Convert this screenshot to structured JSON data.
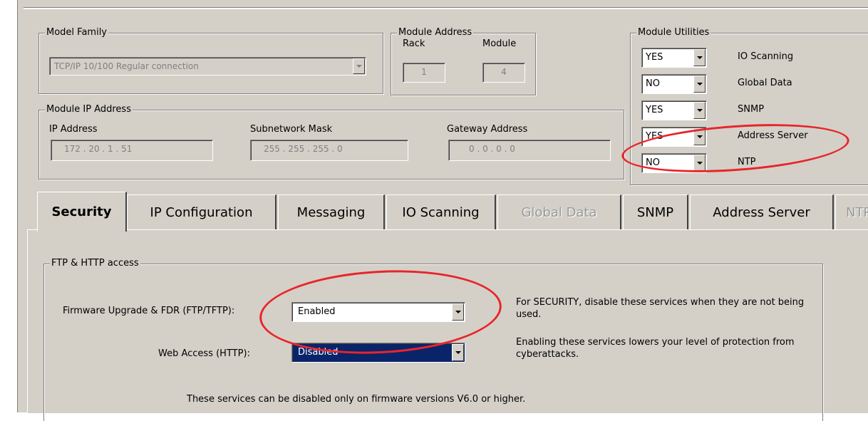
{
  "model_family": {
    "title": "Model Family",
    "value": "TCP/IP 10/100 Regular connection"
  },
  "module_address": {
    "title": "Module Address",
    "rack_label": "Rack",
    "rack_value": "1",
    "module_label": "Module",
    "module_value": "4"
  },
  "module_ip": {
    "title": "Module IP Address",
    "ip_label": "IP Address",
    "ip_value": "172 .  20  .   1   .  51",
    "mask_label": "Subnetwork Mask",
    "mask_value": "255 . 255 . 255 .   0",
    "gateway_label": "Gateway Address",
    "gateway_value": "0   .   0   .   0   .   0"
  },
  "module_utilities": {
    "title": "Module Utilities",
    "rows": [
      {
        "value": "YES",
        "label": "IO Scanning"
      },
      {
        "value": "NO",
        "label": "Global Data"
      },
      {
        "value": "YES",
        "label": "SNMP"
      },
      {
        "value": "YES",
        "label": "Address Server"
      },
      {
        "value": "NO",
        "label": "NTP"
      }
    ]
  },
  "tabs": [
    {
      "label": "Security",
      "state": "active"
    },
    {
      "label": "IP Configuration",
      "state": "normal"
    },
    {
      "label": "Messaging",
      "state": "normal"
    },
    {
      "label": "IO Scanning",
      "state": "normal"
    },
    {
      "label": "Global Data",
      "state": "disabled"
    },
    {
      "label": "SNMP",
      "state": "normal"
    },
    {
      "label": "Address Server",
      "state": "normal"
    },
    {
      "label": "NTP",
      "state": "disabled"
    }
  ],
  "security": {
    "group_title": "FTP & HTTP access",
    "firmware_label": "Firmware Upgrade & FDR (FTP/TFTP):",
    "firmware_value": "Enabled",
    "web_label": "Web Access (HTTP):",
    "web_value": "Disabled",
    "note1": "For SECURITY, disable these services when they are not being used.",
    "note2": "Enabling these services lowers your level of protection from cyberattacks.",
    "footer": "These services can be disabled only on firmware versions V6.0 or higher."
  },
  "colors": {
    "window_bg": "#d4d0c8",
    "selection": "#0a246a",
    "annotation": "#e8252a"
  }
}
